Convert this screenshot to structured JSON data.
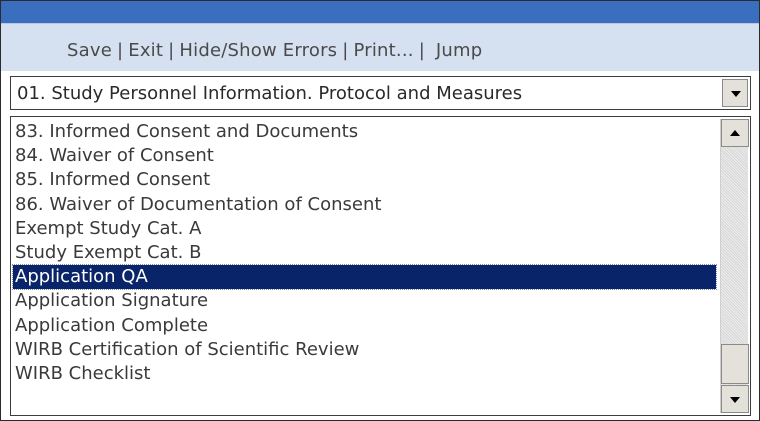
{
  "toolbar": {
    "items": [
      "Save",
      "Exit",
      "Hide/Show Errors",
      "Print...",
      "Jump"
    ],
    "separator": "|"
  },
  "section_select": {
    "selected": "01. Study Personnel Information. Protocol and Measures"
  },
  "list": {
    "items": [
      "83. Informed Consent and Documents",
      "84. Waiver of Consent",
      "85. Informed Consent",
      "86. Waiver of Documentation of Consent",
      "Exempt Study Cat. A",
      "Study Exempt Cat. B",
      "Application QA",
      "Application Signature",
      "Application Complete",
      "WIRB Certification of Scientific Review",
      "WIRB Checklist"
    ],
    "selected_item": "Application QA"
  },
  "colors": {
    "header_bar": "#3a6fbf",
    "toolbar_bg": "#d5e0f0",
    "selection_bg": "#0a246a",
    "selection_text": "#ffffff"
  },
  "icons": {
    "combo_dropdown": "chevron-down-icon",
    "scroll_up": "arrow-up-icon",
    "scroll_down": "arrow-down-icon"
  }
}
